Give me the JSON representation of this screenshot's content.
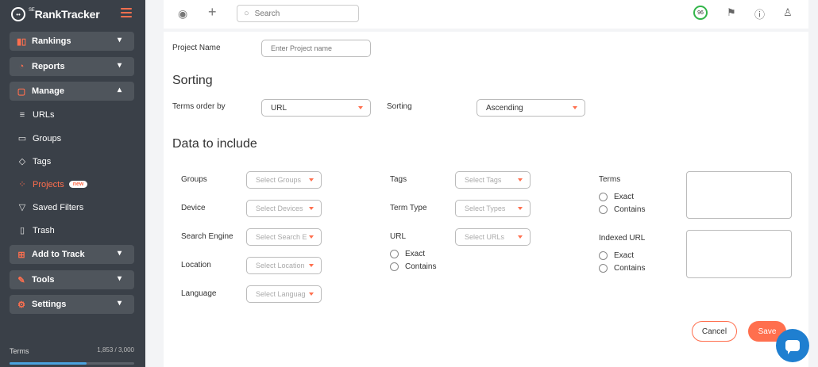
{
  "brand": {
    "name": "RankTracker",
    "prefix": "SE"
  },
  "sidebar": {
    "menus": [
      {
        "label": "Rankings",
        "icon": "bar-chart-icon",
        "glyph": "▮▯",
        "chev": "▾"
      },
      {
        "label": "Reports",
        "icon": "pie-chart-icon",
        "glyph": "◔",
        "chev": "▾"
      },
      {
        "label": "Manage",
        "icon": "document-icon",
        "glyph": "▢",
        "chev": "▴"
      },
      {
        "label": "Add to Track",
        "icon": "plus-square-icon",
        "glyph": "⊞",
        "chev": "▾"
      },
      {
        "label": "Tools",
        "icon": "wand-icon",
        "glyph": "✎",
        "chev": "▾"
      },
      {
        "label": "Settings",
        "icon": "gear-icon",
        "glyph": "⚙",
        "chev": "▾"
      }
    ],
    "subitems": [
      {
        "label": "URLs",
        "icon": "list-icon",
        "glyph": "≡"
      },
      {
        "label": "Groups",
        "icon": "folder-icon",
        "glyph": "▭"
      },
      {
        "label": "Tags",
        "icon": "tag-icon",
        "glyph": "◇"
      },
      {
        "label": "Projects",
        "icon": "projects-icon",
        "glyph": "⁘",
        "badge": "new"
      },
      {
        "label": "Saved Filters",
        "icon": "filter-icon",
        "glyph": "▽"
      },
      {
        "label": "Trash",
        "icon": "trash-icon",
        "glyph": "▯"
      }
    ],
    "terms_label": "Terms",
    "terms_count": "1,853 / 3,000",
    "terms_progress": 0.6177,
    "accent": "#ff6f4e"
  },
  "topbar": {
    "search_placeholder": "Search",
    "score": "96",
    "icons": [
      "eye-icon",
      "plus-icon",
      "flag-icon",
      "help-icon",
      "user-icon"
    ]
  },
  "form": {
    "project_name_label": "Project Name",
    "project_name_placeholder": "Enter Project name",
    "sorting_heading": "Sorting",
    "terms_order_label": "Terms order by",
    "terms_order_value": "URL",
    "sorting_label": "Sorting",
    "sorting_value": "Ascending",
    "data_heading": "Data to include",
    "groups_label": "Groups",
    "groups_placeholder": "Select Groups",
    "device_label": "Device",
    "device_placeholder": "Select Devices",
    "engine_label": "Search Engine",
    "engine_placeholder": "Select Search E",
    "location_label": "Location",
    "location_placeholder": "Select Location",
    "language_label": "Language",
    "language_placeholder": "Select Languag",
    "tags_label": "Tags",
    "tags_placeholder": "Select Tags",
    "term_type_label": "Term Type",
    "term_type_placeholder": "Select Types",
    "url_label": "URL",
    "url_placeholder": "Select URLs",
    "url_exact": "Exact",
    "url_contains": "Contains",
    "terms_label": "Terms",
    "terms_exact": "Exact",
    "terms_contains": "Contains",
    "indexed_label": "Indexed URL",
    "indexed_exact": "Exact",
    "indexed_contains": "Contains",
    "cancel": "Cancel",
    "save": "Save"
  }
}
